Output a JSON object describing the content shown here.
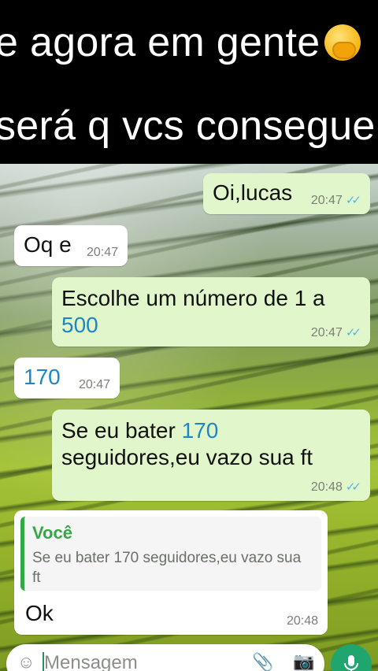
{
  "caption": {
    "line1": "e agora em gente",
    "line2": "será q vcs conseguen",
    "emoji": "face-with-hand-over-mouth"
  },
  "messages": [
    {
      "text": "Oi,lucas",
      "time": "20:47"
    },
    {
      "text": "Oq e",
      "time": "20:47"
    },
    {
      "text_a": "Escolhe um número de 1 a",
      "text_b": "500",
      "time": "20:47"
    },
    {
      "text": "170",
      "time": "20:47"
    },
    {
      "text_a": "Se eu bater ",
      "num": "170",
      "text_b": "seguidores,eu vazo sua ft",
      "time": "20:48"
    },
    {
      "quote_author": "Você",
      "quote_text": "Se eu bater 170 seguidores,eu vazo sua ft",
      "text": "Ok",
      "time": "20:48"
    }
  ],
  "composer": {
    "placeholder": "Mensagem"
  },
  "colors": {
    "outgoing_bubble": "#e1f7cb",
    "incoming_bubble": "#ffffff",
    "read_ticks": "#4fb6ec",
    "accent_green": "#20a56f"
  }
}
